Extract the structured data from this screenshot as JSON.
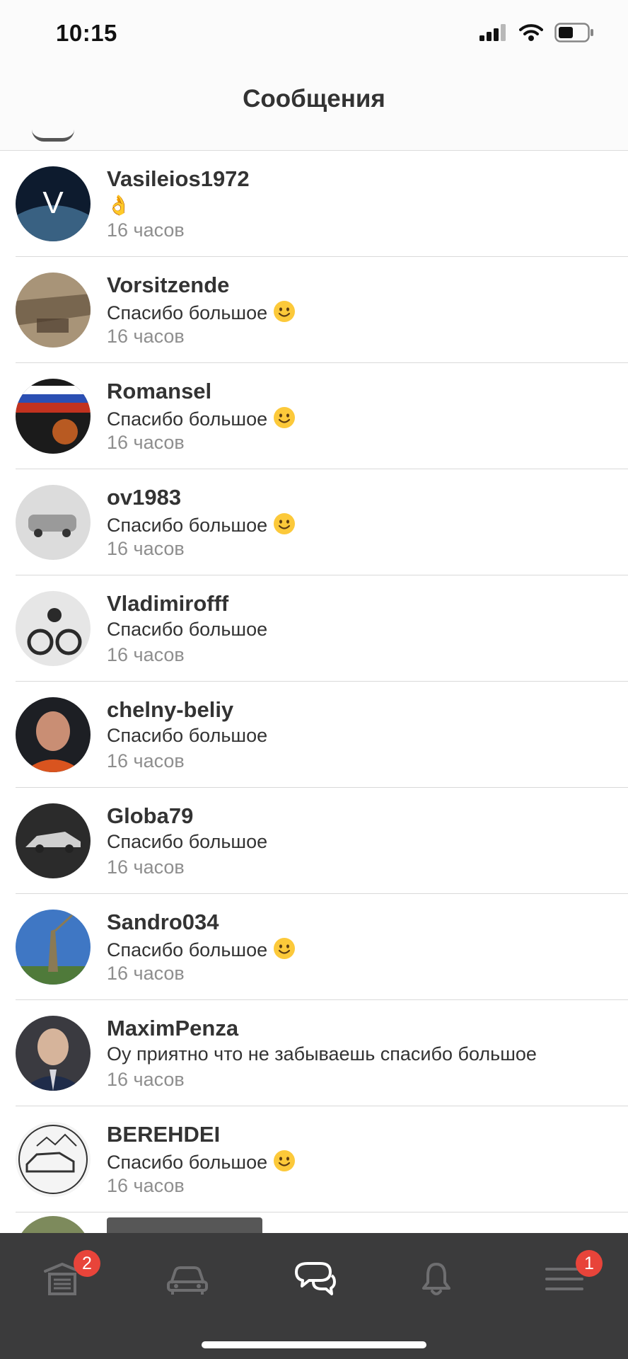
{
  "status_bar": {
    "time": "10:15"
  },
  "header": {
    "title": "Сообщения"
  },
  "conversations": [
    {
      "name": "Vasileios1972",
      "message": "👌",
      "time": "16 часов",
      "avatar_colors": [
        "#0d1b2e",
        "#4d7fa6"
      ]
    },
    {
      "name": "Vorsitzende",
      "message": "Спасибо большое",
      "smile": true,
      "time": "16 часов",
      "avatar_colors": [
        "#6b5a45",
        "#a89478"
      ]
    },
    {
      "name": "Romansel",
      "message": "Спасибо большое",
      "smile": true,
      "time": "16 часов",
      "avatar_colors": [
        "#1b1b1b",
        "#c2321f"
      ]
    },
    {
      "name": "ov1983",
      "message": "Спасибо большое",
      "smile": true,
      "time": "16 часов",
      "avatar_colors": [
        "#dcdcdc",
        "#9a9a9a"
      ]
    },
    {
      "name": "Vladimirofff",
      "message": "Спасибо большое",
      "smile": false,
      "time": "16 часов",
      "avatar_colors": [
        "#e6e6e6",
        "#2a2a2a"
      ]
    },
    {
      "name": "chelny-beliy",
      "message": "Спасибо большое",
      "smile": false,
      "time": "16 часов",
      "avatar_colors": [
        "#1d1f24",
        "#c98e74"
      ]
    },
    {
      "name": "Globa79",
      "message": "Спасибо большое",
      "smile": false,
      "time": "16 часов",
      "avatar_colors": [
        "#2b2b2b",
        "#cfcfcf"
      ]
    },
    {
      "name": "Sandro034",
      "message": "Спасибо большое",
      "smile": true,
      "time": "16 часов",
      "avatar_colors": [
        "#3f77c4",
        "#8a7a55"
      ]
    },
    {
      "name": "MaximPenza",
      "message": "Оу приятно что не забываешь спасибо большое",
      "smile": false,
      "time": "16 часов",
      "avatar_colors": [
        "#3a3a40",
        "#d6b49b"
      ]
    },
    {
      "name": "BEREHDEI",
      "message": "Спасибо большое",
      "smile": true,
      "time": "16 часов",
      "avatar_colors": [
        "#f4f4f4",
        "#333333"
      ]
    }
  ],
  "tab_bar": {
    "tabs": [
      {
        "icon": "garage-icon",
        "badge": "2",
        "active": false
      },
      {
        "icon": "car-icon",
        "badge": "",
        "active": false
      },
      {
        "icon": "chat-bubbles-icon",
        "badge": "",
        "active": true
      },
      {
        "icon": "bell-icon",
        "badge": "",
        "active": false
      },
      {
        "icon": "menu-icon",
        "badge": "1",
        "active": false
      }
    ]
  },
  "colors": {
    "badge": "#e8443a",
    "tab_bar_bg": "#3b3b3c",
    "active_icon": "#ffffff",
    "inactive_icon": "#6e6e70",
    "time_text": "#8e8e8e"
  }
}
